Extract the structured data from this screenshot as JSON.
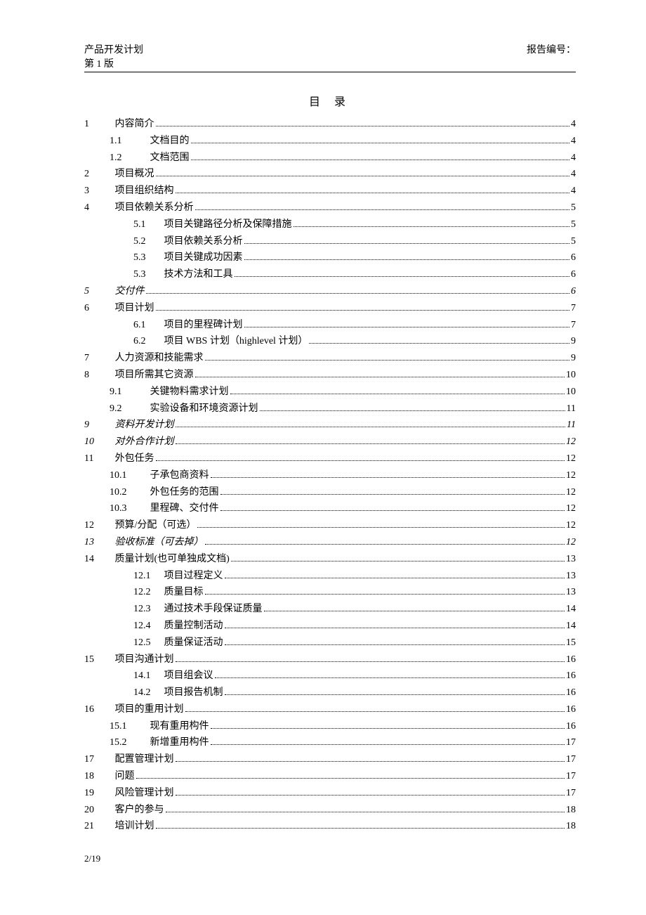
{
  "header": {
    "doc_title": "产品开发计划",
    "version": "第 1 版",
    "report_label": "报告编号："
  },
  "toc_title": "目  录",
  "footer": "2/19",
  "entries": [
    {
      "indent": 0,
      "italic": false,
      "num": "1",
      "text": "内容简介",
      "page": "4"
    },
    {
      "indent": 1,
      "italic": false,
      "num": "1.1",
      "text": "文档目的",
      "page": "4",
      "wide": true
    },
    {
      "indent": 1,
      "italic": false,
      "num": "1.2",
      "text": "文档范围",
      "page": "4",
      "wide": true
    },
    {
      "indent": 0,
      "italic": false,
      "num": "2",
      "text": "项目概况",
      "page": "4"
    },
    {
      "indent": 0,
      "italic": false,
      "num": "3",
      "text": "项目组织结构",
      "page": "4"
    },
    {
      "indent": 0,
      "italic": false,
      "num": "4",
      "text": "项目依赖关系分析",
      "page": "5"
    },
    {
      "indent": 2,
      "italic": false,
      "num": "5.1",
      "text": "项目关键路径分析及保障措施",
      "page": "5"
    },
    {
      "indent": 2,
      "italic": false,
      "num": "5.2",
      "text": "项目依赖关系分析",
      "page": "5"
    },
    {
      "indent": 2,
      "italic": false,
      "num": "5.3",
      "text": "项目关键成功因素",
      "page": "6"
    },
    {
      "indent": 2,
      "italic": false,
      "num": "5.3",
      "text": "技术方法和工具",
      "page": "6"
    },
    {
      "indent": 0,
      "italic": true,
      "num": "5",
      "text": "交付件",
      "page": "6"
    },
    {
      "indent": 0,
      "italic": false,
      "num": "6",
      "text": "项目计划",
      "page": "7"
    },
    {
      "indent": 2,
      "italic": false,
      "num": "6.1",
      "text": "项目的里程碑计划",
      "page": "7"
    },
    {
      "indent": 2,
      "italic": false,
      "num": "6.2",
      "text": "项目 WBS 计划（highlevel 计划）",
      "page": "9"
    },
    {
      "indent": 0,
      "italic": false,
      "num": "7",
      "text": "人力资源和技能需求",
      "page": "9"
    },
    {
      "indent": 0,
      "italic": false,
      "num": "8",
      "text": "项目所需其它资源",
      "page": "10"
    },
    {
      "indent": 1,
      "italic": false,
      "num": "9.1",
      "text": "关键物料需求计划",
      "page": "10",
      "wide": true
    },
    {
      "indent": 1,
      "italic": false,
      "num": "9.2",
      "text": "实验设备和环境资源计划",
      "page": "11",
      "wide": true
    },
    {
      "indent": 0,
      "italic": true,
      "num": "9",
      "text": "资料开发计划",
      "page": "11"
    },
    {
      "indent": 0,
      "italic": true,
      "num": "10",
      "text": "对外合作计划",
      "page": "12"
    },
    {
      "indent": 0,
      "italic": false,
      "num": "11",
      "text": "外包任务",
      "page": "12"
    },
    {
      "indent": 1,
      "italic": false,
      "num": "10.1",
      "text": "子承包商资料",
      "page": "12",
      "wide": true
    },
    {
      "indent": 1,
      "italic": false,
      "num": "10.2",
      "text": "外包任务的范围",
      "page": "12",
      "wide": true
    },
    {
      "indent": 1,
      "italic": false,
      "num": "10.3",
      "text": "里程碑、交付件",
      "page": "12",
      "wide": true
    },
    {
      "indent": 0,
      "italic": false,
      "num": "12",
      "text": "预算/分配（可选）",
      "page": "12"
    },
    {
      "indent": 0,
      "italic": true,
      "num": "13",
      "text": "验收标准（可去掉）",
      "page": "12"
    },
    {
      "indent": 0,
      "italic": false,
      "num": "14",
      "text": "质量计划(也可单独成文档)",
      "page": "13"
    },
    {
      "indent": 2,
      "italic": false,
      "num": "12.1",
      "text": "项目过程定义",
      "page": "13"
    },
    {
      "indent": 2,
      "italic": false,
      "num": "12.2",
      "text": "质量目标",
      "page": "13"
    },
    {
      "indent": 2,
      "italic": false,
      "num": "12.3",
      "text": "通过技术手段保证质量",
      "page": "14"
    },
    {
      "indent": 2,
      "italic": false,
      "num": "12.4",
      "text": "质量控制活动",
      "page": "14"
    },
    {
      "indent": 2,
      "italic": false,
      "num": "12.5",
      "text": "质量保证活动",
      "page": "15"
    },
    {
      "indent": 0,
      "italic": false,
      "num": "15",
      "text": "项目沟通计划",
      "page": "16"
    },
    {
      "indent": 2,
      "italic": false,
      "num": "14.1",
      "text": "项目组会议",
      "page": "16"
    },
    {
      "indent": 2,
      "italic": false,
      "num": "14.2",
      "text": "项目报告机制",
      "page": "16"
    },
    {
      "indent": 0,
      "italic": false,
      "num": "16",
      "text": "项目的重用计划",
      "page": "16"
    },
    {
      "indent": 1,
      "italic": false,
      "num": "15.1",
      "text": "现有重用构件",
      "page": "16",
      "wide": true
    },
    {
      "indent": 1,
      "italic": false,
      "num": "15.2",
      "text": "新增重用构件",
      "page": "17",
      "wide": true
    },
    {
      "indent": 0,
      "italic": false,
      "num": "17",
      "text": "配置管理计划",
      "page": "17"
    },
    {
      "indent": 0,
      "italic": false,
      "num": "18",
      "text": "问题",
      "page": "17"
    },
    {
      "indent": 0,
      "italic": false,
      "num": "19",
      "text": "风险管理计划",
      "page": "17"
    },
    {
      "indent": 0,
      "italic": false,
      "num": "20",
      "text": "客户的参与",
      "page": "18"
    },
    {
      "indent": 0,
      "italic": false,
      "num": "21",
      "text": "培训计划",
      "page": "18"
    }
  ]
}
